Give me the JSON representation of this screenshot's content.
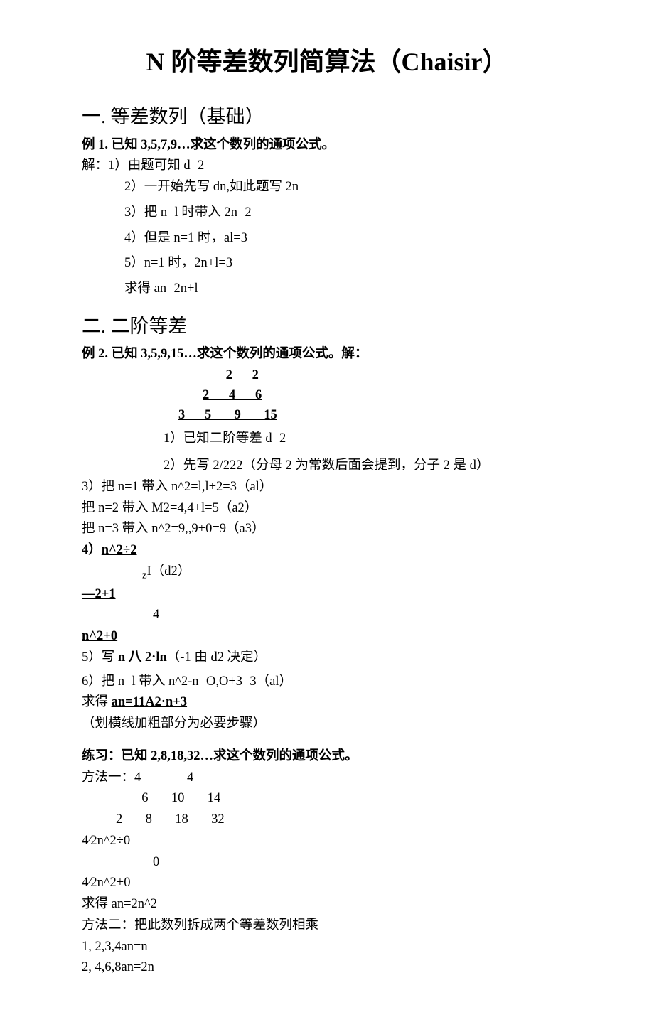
{
  "title": "N 阶等差数列简算法（Chaisir）",
  "sec1": {
    "heading": "一. 等差数列（基础）",
    "ex_label": "例 1. 已知 3,5,7,9…求这个数列的通项公式。",
    "solve": "解：1）由题可知 d=2",
    "s2": "2）一开始先写 dn,如此题写 2n",
    "s3": "3）把 n=l 时带入 2n=2",
    "s4": "4）但是 n=1 时，al=3",
    "s5": "5）n=1 时，2n+l=3",
    "s6": "求得 an=2n+l"
  },
  "sec2": {
    "heading": "二. 二阶等差",
    "ex_label": "例 2. 已知 3,5,9,15…求这个数列的通项公式。解：",
    "p_row1": " 2      2",
    "p_row2": "2      4      6",
    "p_row3": "3      5       9       15",
    "s1": "1）已知二阶等差 d=2",
    "s2": "2）先写 2/222（分母 2 为常数后面会提到，分子 2 是 d）",
    "s3": "3）把 n=1 带入 n^2=l,l+2=3（al）",
    "s4": "把 n=2 带入 M2=4,4+l=5（a2）",
    "s5": "把 n=3 带入 n^2=9,,9+0=9（a3）",
    "s6a": "4）",
    "s6b": "n^2÷2",
    "s7a": "I（d2）",
    "s8": "—2+1",
    "s9": "4",
    "s10": "n^2+0",
    "s11a": "5）写 ",
    "s11b": "n 八 2·ln",
    "s11c": "（-1 由 d2 决定）",
    "s12": "6）把 n=l 带入 n^2-n=O,O+3=3（al）",
    "s13a": "求得 ",
    "s13b": "an=11A2·n+3",
    "s14": "（划横线加粗部分为必要步骤）",
    "pr_label": "练习：已知 2,8,18,32…求这个数列的通项公式。",
    "m1_row1": "方法一：4              4",
    "m1_row2": "  6       10       14",
    "m1_row3": "2       8       18       32",
    "m1_s1": "4⁄2n^2÷0",
    "m1_s2": "0",
    "m1_s3": "4⁄2n^2+0",
    "m1_s4": "求得 an=2n^2",
    "m2_label": "方法二：把此数列拆成两个等差数列相乘",
    "m2_s1": "1,   2,3,4an=n",
    "m2_s2": "2,   4,6,8an=2n"
  }
}
